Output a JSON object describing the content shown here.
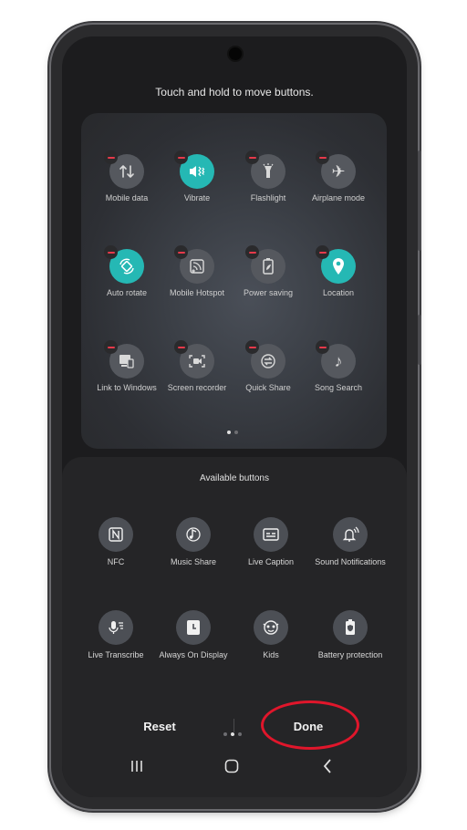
{
  "hint": "Touch and hold to move buttons.",
  "active_tiles": [
    {
      "label": "Mobile data",
      "icon": "swap-vert-icon",
      "on": false
    },
    {
      "label": "Vibrate",
      "icon": "vibrate-icon",
      "on": true
    },
    {
      "label": "Flashlight",
      "icon": "flashlight-icon",
      "on": false
    },
    {
      "label": "Airplane mode",
      "icon": "airplane-icon",
      "on": false
    },
    {
      "label": "Auto rotate",
      "icon": "auto-rotate-icon",
      "on": true
    },
    {
      "label": "Mobile Hotspot",
      "icon": "hotspot-icon",
      "on": false
    },
    {
      "label": "Power saving",
      "icon": "battery-leaf-icon",
      "on": false
    },
    {
      "label": "Location",
      "icon": "location-pin-icon",
      "on": true
    },
    {
      "label": "Link to Windows",
      "icon": "link-windows-icon",
      "on": false
    },
    {
      "label": "Screen recorder",
      "icon": "screen-recorder-icon",
      "on": false
    },
    {
      "label": "Quick Share",
      "icon": "quick-share-icon",
      "on": false
    },
    {
      "label": "Song Search",
      "icon": "music-note-icon",
      "on": false
    }
  ],
  "available_title": "Available buttons",
  "available_buttons": [
    {
      "label": "NFC",
      "icon": "nfc-icon"
    },
    {
      "label": "Music Share",
      "icon": "music-share-icon"
    },
    {
      "label": "Live Caption",
      "icon": "live-caption-icon"
    },
    {
      "label": "Sound Notifications",
      "icon": "sound-notifications-icon"
    },
    {
      "label": "Live Transcribe",
      "icon": "live-transcribe-icon"
    },
    {
      "label": "Always On Display",
      "icon": "always-on-display-icon"
    },
    {
      "label": "Kids",
      "icon": "kids-icon"
    },
    {
      "label": "Battery protection",
      "icon": "battery-protection-icon"
    }
  ],
  "reset_label": "Reset",
  "done_label": "Done",
  "colors": {
    "accent": "#25b8b4",
    "highlight_ring": "#e0162b",
    "remove_minus": "#e6394a"
  },
  "top_pager": {
    "pages": 2,
    "current": 1
  },
  "bottom_pager": {
    "pages": 3,
    "current": 2
  }
}
